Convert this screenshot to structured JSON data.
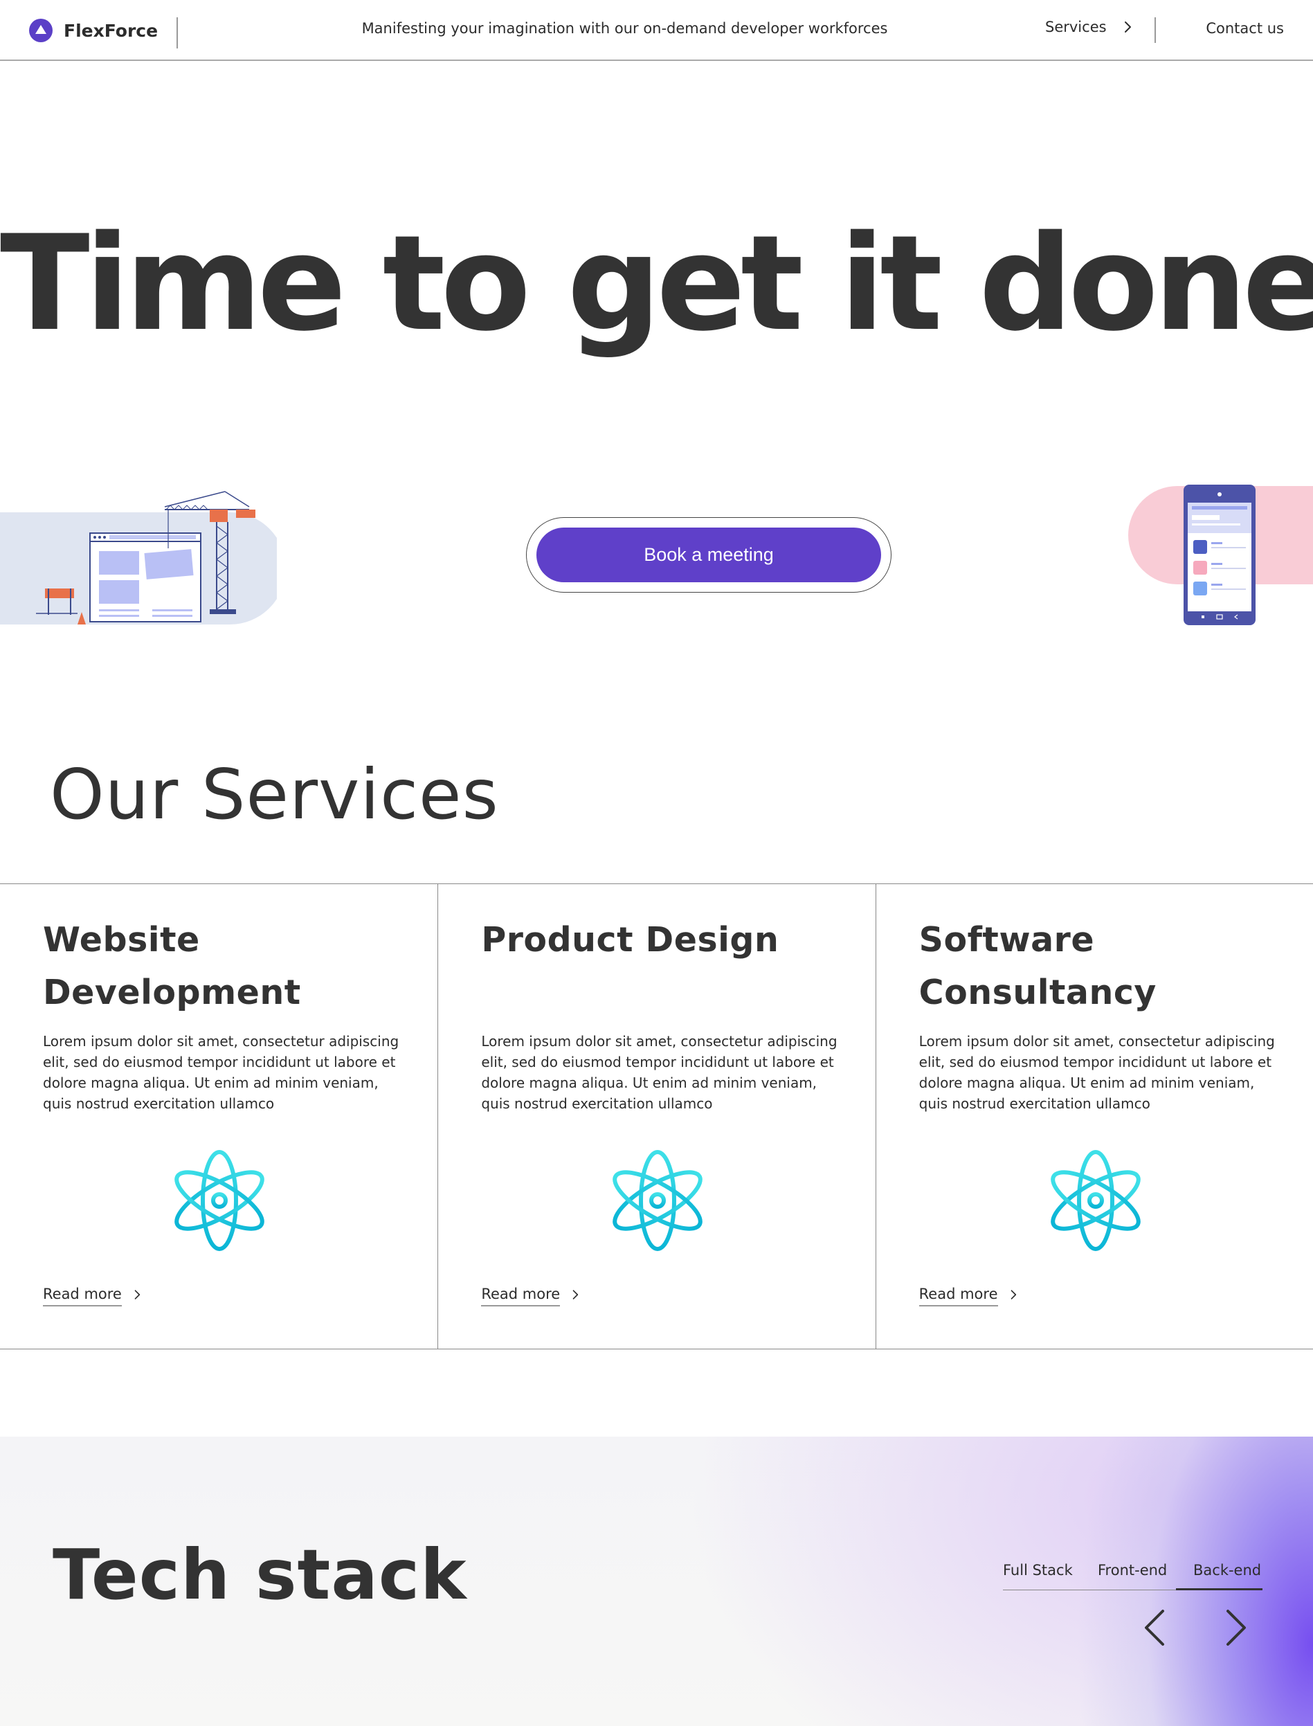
{
  "nav": {
    "brand": "FlexForce",
    "tagline": "Manifesting your imagination with our on-demand developer workforces",
    "services_label": "Services",
    "contact_label": "Contact us"
  },
  "hero": {
    "title": "Time to get it done",
    "cta_label": "Book a meeting"
  },
  "services": {
    "heading": "Our Services",
    "cards": [
      {
        "title": "Website Development",
        "body": "Lorem ipsum dolor sit amet, consectetur adipiscing elit, sed do eiusmod tempor incididunt ut labore et dolore magna aliqua. Ut enim ad minim veniam, quis nostrud exercitation ullamco",
        "icon": "atom-icon",
        "link": "Read more"
      },
      {
        "title": "Product Design",
        "body": "Lorem ipsum dolor sit amet, consectetur adipiscing elit, sed do eiusmod tempor incididunt ut labore et dolore magna aliqua. Ut enim ad minim veniam, quis nostrud exercitation ullamco",
        "icon": "atom-icon",
        "link": "Read more"
      },
      {
        "title": "Software Consultancy",
        "body": "Lorem ipsum dolor sit amet, consectetur adipiscing elit, sed do eiusmod tempor incididunt ut labore et dolore magna aliqua. Ut enim ad minim veniam, quis nostrud exercitation ullamco",
        "icon": "atom-icon",
        "link": "Read more"
      }
    ]
  },
  "tech": {
    "heading": "Tech stack",
    "tabs": [
      "Full Stack",
      "Front-end",
      "Back-end"
    ],
    "active_tab": "Back-end"
  },
  "colors": {
    "brand": "#5b40c7",
    "cta": "#5f40c9",
    "text": "#333333",
    "atom_gradient": [
      "#3ee0e8",
      "#0bb5d6"
    ]
  }
}
